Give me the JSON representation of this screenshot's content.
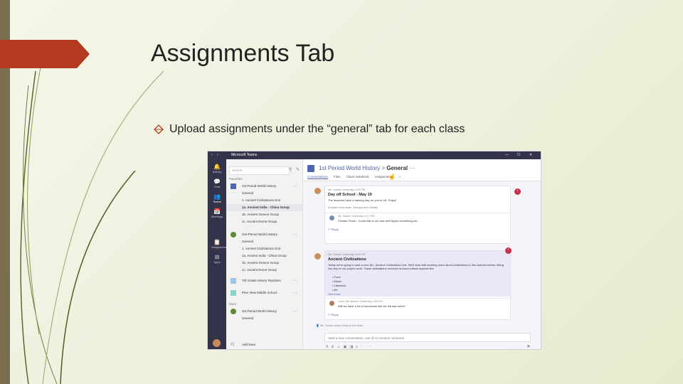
{
  "slide": {
    "title": "Assignments Tab",
    "bullet": "Upload assignments under the “general” tab for each class"
  },
  "colors": {
    "accent": "#b33a1e",
    "teams_purple": "#4b5fa8",
    "teams_rail": "#33344a",
    "alert": "#c4314b"
  },
  "teams": {
    "app_title": "Microsoft Teams",
    "rail": [
      {
        "icon": "bell-icon",
        "label": "Activity"
      },
      {
        "icon": "chat-icon",
        "label": "Chat"
      },
      {
        "icon": "teams-icon",
        "label": "Teams"
      },
      {
        "icon": "calendar-icon",
        "label": "Meetings"
      },
      {
        "icon": "assignments-icon",
        "label": "Assignments"
      },
      {
        "icon": "apps-icon",
        "label": "Apps"
      }
    ],
    "search_placeholder": "Search",
    "favorites_header": "Favorites",
    "more_header": "More",
    "team1": {
      "name": "1st Period World History",
      "channels": [
        "General",
        "1. Ancient Civilizations Unit",
        "1a. Ancient India - China Group",
        "1b. Ancient Greece Group",
        "1c. Ancient Rome Group"
      ]
    },
    "team2": {
      "name": "2nd Period World History",
      "channels": [
        "General",
        "1. Ancient Civilizations Unit",
        "1a. Ancient India - China Group",
        "1b. Ancient Greece Group",
        "1c. Ancient Rome Group"
      ]
    },
    "team3": {
      "name": "7th Grade History Teachers"
    },
    "team4": {
      "name": "Pine View Middle School"
    },
    "team5": {
      "name": "3rd Period World History",
      "channels": [
        "General"
      ]
    },
    "add_team": "Add team",
    "header": {
      "team": "1st Period World History",
      "sep": ">",
      "channel": "General",
      "more": "···"
    },
    "tabs": [
      "Conversations",
      "Files",
      "Class Notebook",
      "Assignments",
      "+"
    ],
    "post1": {
      "meta": "Ms. Sanker   Yesterday 4:09 PM",
      "title": "Day off School - May 19",
      "text": "The teachers have a training day, so you're off . Enjoy!",
      "sub": "8 replies from Isaac, Georgia and Christie",
      "reply_meta": "Mr. Sanker   Yesterday 4:57 PM",
      "reply_text": "Christie Frank - Come talk to me and we'll figure something out.",
      "reply_label": "Reply"
    },
    "post2": {
      "meta": "Ms. Sanker   Yesterday 4:09 PM",
      "title": "Ancient Civilizations",
      "text": "Today we're going to start a new @1. Ancient Civilizations Unit. We'll start with learning more about civilizations in this channel before diving into any of our project work. These civilizations revolved around cultural aspects like:",
      "items": [
        "Food",
        "Music",
        "Literature",
        "Art"
      ],
      "see_more": "See more",
      "reply_meta": "Louis Van Beeten   Yesterday 4:59 PM",
      "reply_text": "Will we have a lot of homework like we did last week?",
      "reply_label": "Reply"
    },
    "system_msg": "Ms. Sanker added Holly to the team",
    "compose_placeholder": "Start a new conversation, use @ to mention someone"
  }
}
